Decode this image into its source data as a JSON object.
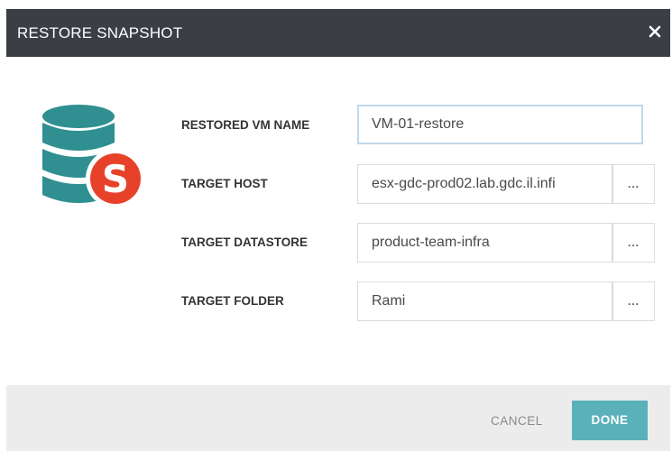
{
  "dialog": {
    "title": "RESTORE SNAPSHOT",
    "close_icon": "close-icon",
    "logo_icon": "database-snapshot-icon",
    "logo_badge_letter": "S"
  },
  "form": {
    "vm_name": {
      "label": "RESTORED VM NAME",
      "value": "VM-01-restore"
    },
    "target_host": {
      "label": "TARGET HOST",
      "value": "esx-gdc-prod02.lab.gdc.il.infi",
      "browse_label": "..."
    },
    "target_datastore": {
      "label": "TARGET DATASTORE",
      "value": "product-team-infra",
      "browse_label": "..."
    },
    "target_folder": {
      "label": "TARGET FOLDER",
      "value": "Rami",
      "browse_label": "..."
    }
  },
  "footer": {
    "cancel_label": "CANCEL",
    "done_label": "DONE"
  },
  "colors": {
    "titlebar": "#3b3e45",
    "footer": "#ececec",
    "accent_teal": "#5ab1ba",
    "logo_teal": "#2f8f91",
    "badge_red": "#e8412a"
  }
}
